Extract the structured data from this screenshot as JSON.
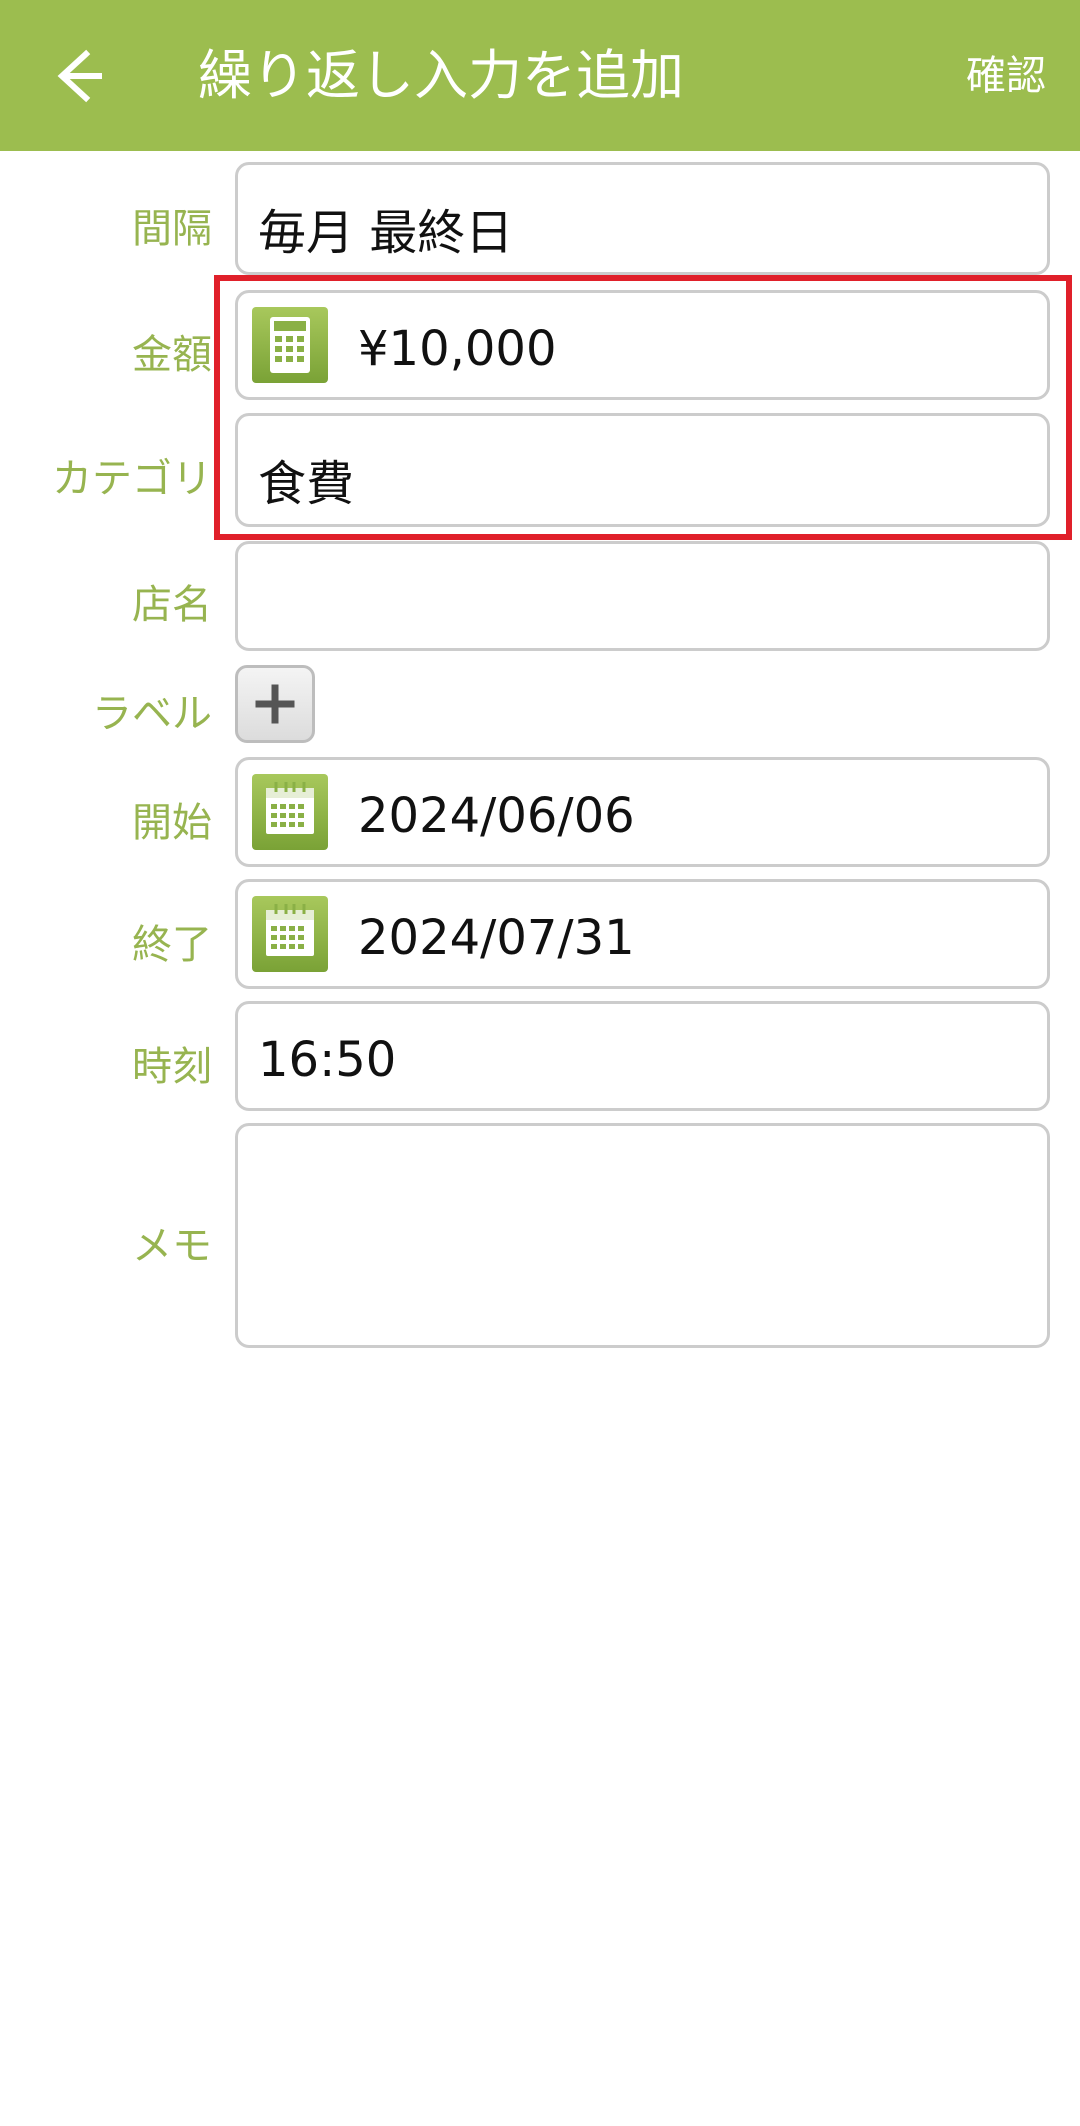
{
  "app_bar": {
    "title": "繰り返し入力を追加",
    "confirm_label": "確認",
    "background_color": "#9cbd4f"
  },
  "form": {
    "interval": {
      "label": "間隔",
      "value": "毎月 最終日"
    },
    "amount": {
      "label": "金額",
      "value": "¥10,000",
      "icon": "calculator-icon"
    },
    "category": {
      "label": "カテゴリ",
      "value": "食費"
    },
    "store": {
      "label": "店名",
      "value": ""
    },
    "tags": {
      "label": "ラベル",
      "add_icon": "plus-icon"
    },
    "start": {
      "label": "開始",
      "value": "2024/06/06",
      "icon": "calendar-icon"
    },
    "end": {
      "label": "終了",
      "value": "2024/07/31",
      "icon": "calendar-icon"
    },
    "time": {
      "label": "時刻",
      "value": "16:50"
    },
    "memo": {
      "label": "メモ",
      "value": ""
    }
  },
  "colors": {
    "label": "#97b450",
    "border": "#cccccc",
    "highlight": "#e0202a"
  }
}
